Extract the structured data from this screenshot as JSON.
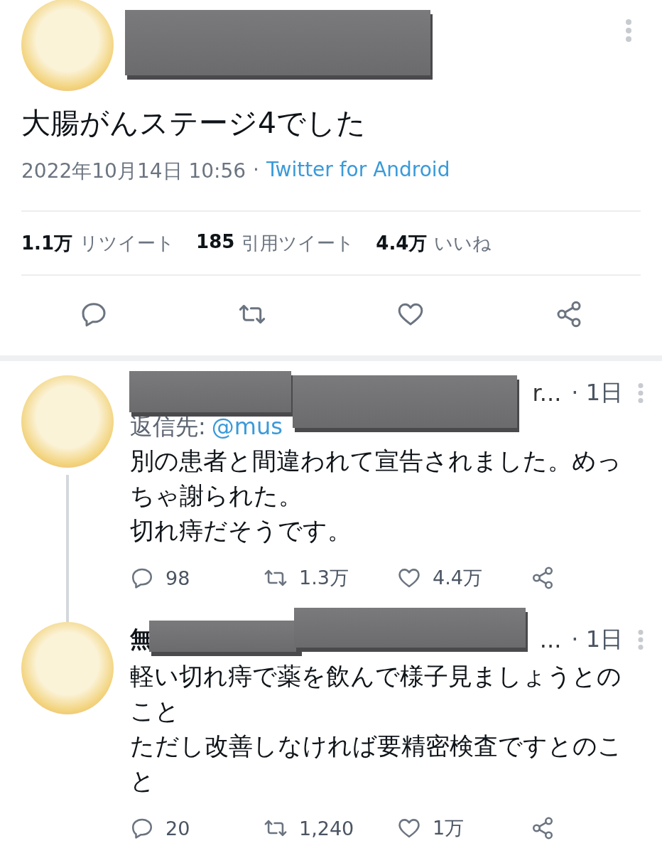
{
  "tweet": {
    "text": "大腸がんステージ4でした",
    "date": "2022年10月14日 10:56",
    "separator": "·",
    "source": "Twitter for Android",
    "stats": [
      {
        "count": "1.1万",
        "label": "リツイート"
      },
      {
        "count": "185",
        "label": "引用ツイート"
      },
      {
        "count": "4.4万",
        "label": "いいね"
      }
    ],
    "actions": [
      {
        "kind": "reply"
      },
      {
        "kind": "retweet"
      },
      {
        "kind": "like"
      },
      {
        "kind": "share"
      }
    ]
  },
  "replies": [
    {
      "name_end": "r...",
      "time": "· 1日",
      "reply_to_label": "返信先:",
      "reply_to_handle": "@mus",
      "paragraphs": [
        "別の患者と間違われて宣告されました。めっちゃ謝られた。",
        "切れ痔だそうです。"
      ],
      "actions": [
        {
          "kind": "reply",
          "count": "98"
        },
        {
          "kind": "retweet",
          "count": "1.3万"
        },
        {
          "kind": "like",
          "count": "4.4万"
        },
        {
          "kind": "share"
        }
      ]
    },
    {
      "name_start": "無",
      "name_end": "...",
      "time": "· 1日",
      "paragraphs": [
        "軽い切れ痔で薬を飲んで様子見ましょうとのこと",
        "ただし改善しなければ要精密検査ですとのこと"
      ],
      "actions": [
        {
          "kind": "reply",
          "count": "20"
        },
        {
          "kind": "retweet",
          "count": "1,240"
        },
        {
          "kind": "like",
          "count": "1万"
        },
        {
          "kind": "share"
        }
      ]
    }
  ]
}
